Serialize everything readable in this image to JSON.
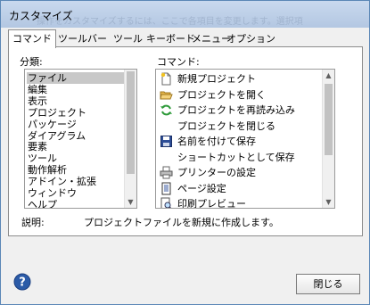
{
  "window": {
    "title": "カスタマイズ",
    "title_ghost": "操作をカスタマイズするには、ここで各項目を変更します。選択項目の操作方法を確認"
  },
  "tabs": [
    {
      "label": "コマンド",
      "active": true
    },
    {
      "label": "ツールバー",
      "active": false
    },
    {
      "label": "ツール",
      "active": false
    },
    {
      "label": "キーボード",
      "active": false
    },
    {
      "label": "メニュー",
      "active": false
    },
    {
      "label": "オプション",
      "active": false
    }
  ],
  "categories": {
    "label": "分類:",
    "items": [
      "ファイル",
      "編集",
      "表示",
      "プロジェクト",
      "パッケージ",
      "ダイアグラム",
      "要素",
      "ツール",
      "動作解析",
      "アドイン・拡張",
      "ウィンドウ",
      "ヘルプ"
    ],
    "selected_index": 0
  },
  "commands": {
    "label": "コマンド:",
    "items": [
      {
        "label": "新規プロジェクト",
        "icon": "new-project-icon"
      },
      {
        "label": "プロジェクトを開く",
        "icon": "open-folder-icon"
      },
      {
        "label": "プロジェクトを再読み込み",
        "icon": "reload-icon"
      },
      {
        "label": "プロジェクトを閉じる",
        "icon": ""
      },
      {
        "label": "名前を付けて保存",
        "icon": "save-icon"
      },
      {
        "label": "ショートカットとして保存",
        "icon": ""
      },
      {
        "label": "プリンターの設定",
        "icon": "printer-icon"
      },
      {
        "label": "ページ設定",
        "icon": "page-setup-icon"
      },
      {
        "label": "印刷プレビュー",
        "icon": "print-preview-icon"
      }
    ]
  },
  "description": {
    "label": "説明:",
    "text": "プロジェクトファイルを新規に作成します。"
  },
  "buttons": {
    "close": "閉じる",
    "help": "?"
  },
  "colors": {
    "selection": "#c8c8c8",
    "help_blue": "#2b5ba7",
    "title_bar": "#c1d3eb"
  }
}
